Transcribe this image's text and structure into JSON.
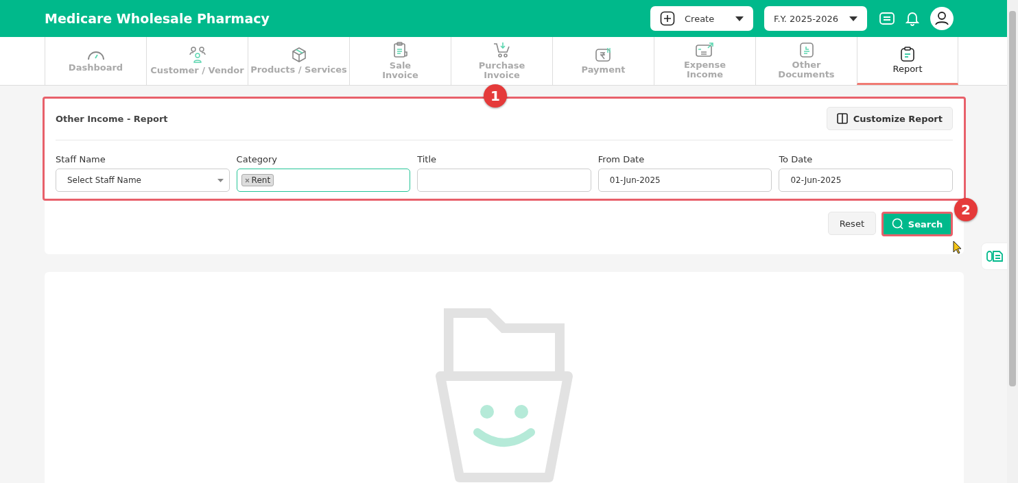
{
  "header": {
    "title": "Medicare Wholesale Pharmacy",
    "create_button": "Create",
    "year_selector": "F.Y. 2025-2026"
  },
  "tabs": [
    {
      "label": "Dashboard",
      "selected": false
    },
    {
      "label": "Customer / Vendor",
      "selected": false
    },
    {
      "label": "Products / Services",
      "selected": false
    },
    {
      "label": "Sale\nInvoice",
      "selected": false
    },
    {
      "label": "Purchase\nInvoice",
      "selected": false
    },
    {
      "label": "Payment",
      "selected": false
    },
    {
      "label": "Expense\nIncome",
      "selected": false
    },
    {
      "label": "Other\nDocuments",
      "selected": false
    },
    {
      "label": "Report",
      "selected": true
    }
  ],
  "report": {
    "title": "Other Income - Report",
    "customize_button": "Customize Report",
    "fields": [
      {
        "label": "Staff Name",
        "kind": "select",
        "placeholder": "Select Staff Name"
      },
      {
        "label": "Category",
        "kind": "tags",
        "tags": [
          "Rent"
        ]
      },
      {
        "label": "Title",
        "kind": "text"
      },
      {
        "label": "From Date",
        "kind": "text",
        "value": "01-Jun-2025"
      },
      {
        "label": "To Date",
        "kind": "text",
        "value": "02-Jun-2025"
      }
    ],
    "reset_button": "Reset",
    "search_button": "Search"
  },
  "callouts": [
    "1",
    "2"
  ]
}
